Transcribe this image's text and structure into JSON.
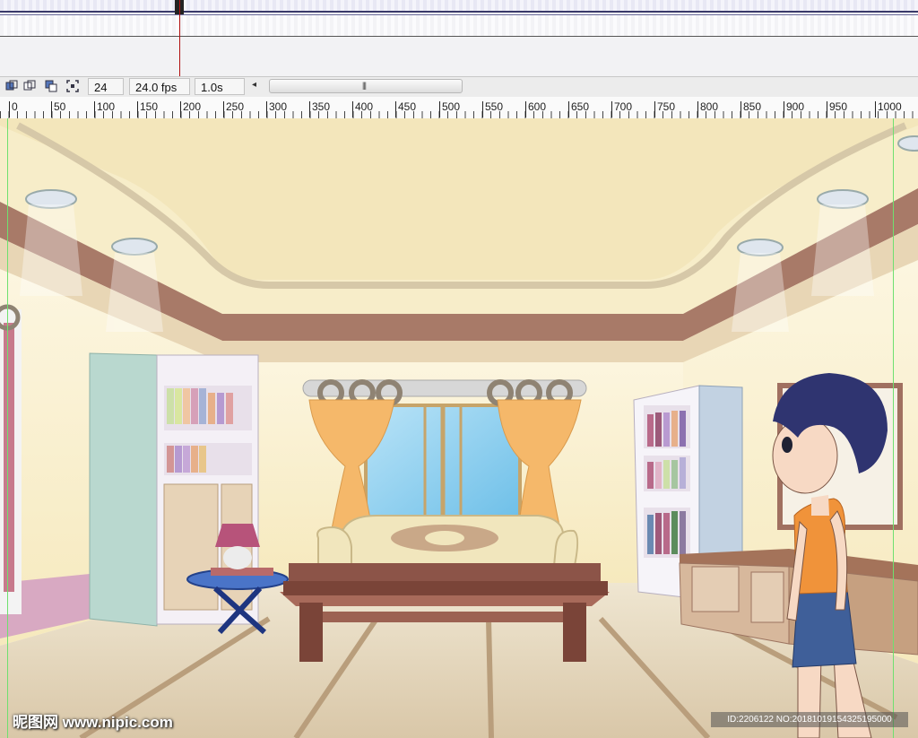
{
  "toolbar": {
    "frame": "24",
    "fps": "24.0 fps",
    "time": "1.0s",
    "scroll_left_arrow": "◂",
    "scroll_grip": "|||"
  },
  "ruler": {
    "labels": [
      "0",
      "50",
      "100",
      "150",
      "200",
      "250",
      "300",
      "350",
      "400",
      "450",
      "500",
      "550",
      "600",
      "650",
      "700",
      "750",
      "800",
      "850",
      "900",
      "950",
      "1000"
    ]
  },
  "watermark": {
    "text": "昵图网 www.nipic.com"
  },
  "id_tag": {
    "text": "ID:2206122 NO:20181019154325195000"
  },
  "colors": {
    "ceiling": "#f7edc9",
    "wall": "#fbf3d8",
    "brown_band": "#a87a68",
    "floor": "#ede4cf",
    "curtain": "#f5b86a",
    "sofa": "#f1e6bd",
    "table": "#7a4438",
    "hair": "#2f3470",
    "top": "#f0933a",
    "skirt": "#3f5f99",
    "guide": "#6fe06f"
  }
}
